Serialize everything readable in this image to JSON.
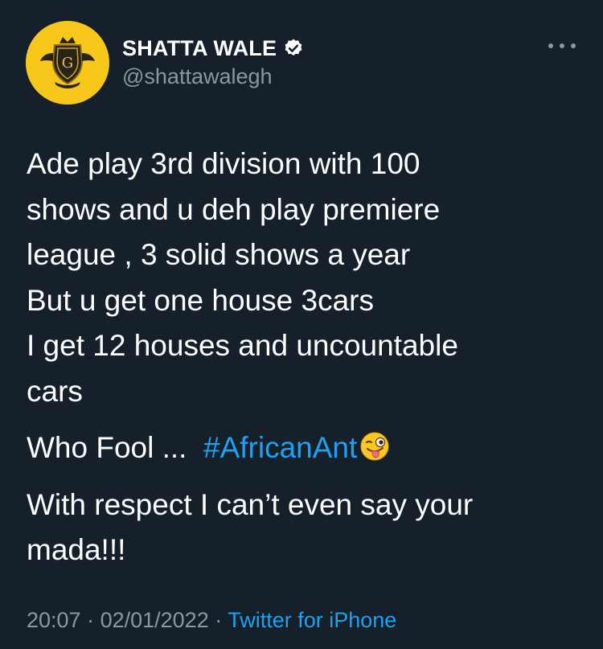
{
  "author": {
    "display_name": "SHATTA WALE",
    "handle": "@shattawalegh",
    "verified": true,
    "avatar_icon": "gold-crest-avatar",
    "avatar_color": "#f7c819"
  },
  "tweet": {
    "lines": [
      "Ade  play 3rd division with 100",
      "shows and u deh play premiere",
      "league , 3 solid shows a year",
      "But u get one house 3cars",
      "I get 12 houses and uncountable",
      "cars"
    ],
    "line2_prefix": "Who Fool ...  ",
    "hashtag": "#AfricanAnt",
    "emoji": "winking-face-with-tongue",
    "closing_lines": [
      "With respect I can’t even say your",
      "mada!!!"
    ]
  },
  "meta": {
    "time": "20:07",
    "separator": " · ",
    "date": "02/01/2022",
    "separator2": " · ",
    "source": "Twitter for iPhone"
  },
  "colors": {
    "background": "#15202b",
    "text": "#ffffff",
    "secondary": "#8899a6",
    "accent": "#1da1f2"
  }
}
